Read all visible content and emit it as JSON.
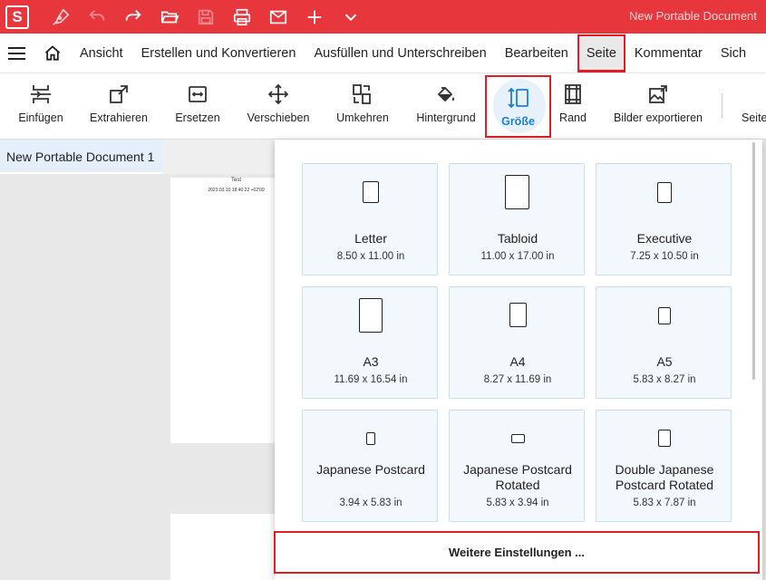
{
  "app": {
    "logo_letter": "S",
    "window_title": "New Portable Document",
    "accent": "#e8363d"
  },
  "quick_access": [
    "pen-icon",
    "undo-icon",
    "redo-icon",
    "open-folder-icon",
    "save-icon",
    "print-icon",
    "mail-icon",
    "plus-icon",
    "chevron-down-icon"
  ],
  "menu": {
    "items": [
      "Ansicht",
      "Erstellen und Konvertieren",
      "Ausfüllen und Unterschreiben",
      "Bearbeiten",
      "Seite",
      "Kommentar",
      "Sich"
    ],
    "active": "Seite"
  },
  "ribbon": {
    "buttons": [
      {
        "label": "Einfügen",
        "icon": "insert-pages-icon"
      },
      {
        "label": "Extrahieren",
        "icon": "extract-icon"
      },
      {
        "label": "Ersetzen",
        "icon": "replace-icon"
      },
      {
        "label": "Verschieben",
        "icon": "move-icon"
      },
      {
        "label": "Umkehren",
        "icon": "reverse-icon"
      },
      {
        "label": "Hintergrund",
        "icon": "paint-bucket-icon"
      },
      {
        "label": "Größe",
        "icon": "page-size-icon",
        "selected": true
      },
      {
        "label": "Rand",
        "icon": "margin-icon"
      },
      {
        "label": "Bilder exportieren",
        "icon": "export-images-icon"
      },
      {
        "label": "Seite",
        "icon": "page-icon"
      }
    ]
  },
  "document": {
    "tab_label": "New Portable Document 1",
    "page_text_title": "Test",
    "page_text_date": "2023.03.10 18:40:22 +02'00"
  },
  "sizes": [
    {
      "name": "Letter",
      "dims": "8.50 x 11.00 in"
    },
    {
      "name": "Tabloid",
      "dims": "11.00 x 17.00 in"
    },
    {
      "name": "Executive",
      "dims": "7.25 x 10.50 in"
    },
    {
      "name": "A3",
      "dims": "11.69 x 16.54 in"
    },
    {
      "name": "A4",
      "dims": "8.27 x 11.69 in"
    },
    {
      "name": "A5",
      "dims": "5.83 x 8.27 in"
    },
    {
      "name": "Japanese Postcard",
      "dims": "3.94 x 5.83 in"
    },
    {
      "name": "Japanese Postcard Rotated",
      "dims": "5.83 x 3.94 in"
    },
    {
      "name": "Double Japanese Postcard Rotated",
      "dims": "5.83 x 7.87 in"
    }
  ],
  "more_settings_label": "Weitere Einstellungen ..."
}
